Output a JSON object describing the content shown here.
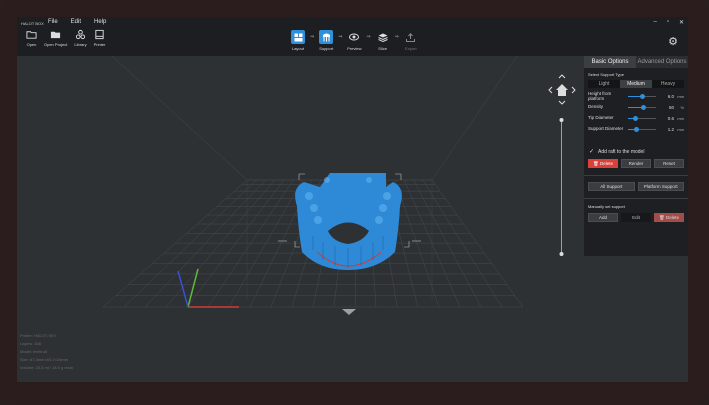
{
  "app": {
    "brand": "HALOT BOX",
    "menu": [
      "File",
      "Edit",
      "Help"
    ],
    "window_controls": [
      "–",
      "▫",
      "✕"
    ]
  },
  "toolbar": {
    "open_label": "Open",
    "open_project_label": "Open Project",
    "library_label": "Library",
    "printer_label": "Printer"
  },
  "pipeline": {
    "layout_label": "Layout",
    "support_label": "Support",
    "preview_label": "Preview",
    "slice_label": "Slice",
    "export_label": "Export",
    "active_step": "Support",
    "arrow": "⇒"
  },
  "panel": {
    "tab_basic": "Basic Options",
    "tab_advanced": "Advanced Options",
    "select_support_type": "Select Support Type",
    "types": [
      "Light",
      "Medium",
      "Heavy"
    ],
    "selected_type": "Medium",
    "params": [
      {
        "name": "Height from platform",
        "value": "6.0",
        "unit": "mm",
        "fraction": 0.5
      },
      {
        "name": "Density",
        "value": "50",
        "unit": "%",
        "fraction": 0.55
      },
      {
        "name": "Tip Diameter",
        "value": "0.6",
        "unit": "mm",
        "fraction": 0.25
      },
      {
        "name": "Support Diameter",
        "value": "1.2",
        "unit": "mm",
        "fraction": 0.3
      }
    ],
    "raft_label": "Add raft to the model",
    "raft_checked": "✓",
    "delete_label": "Delete",
    "render_label": "Render",
    "reset_label": "Reset",
    "all_support_label": "All Support",
    "platform_support_label": "Platform Support",
    "manual_label": "Manually set support",
    "add_label": "Add",
    "edit_label": "Edit",
    "delete2_label": "Delete"
  },
  "info": {
    "lines": [
      "Printer: HALOT-SKY",
      "Layers: 308",
      "Model: teeth.stl",
      "Size: 67.3mm×53.2×24mm",
      "Volume: 23.3 ml / 18.5 g resin"
    ]
  },
  "colors": {
    "accent": "#2f8fd8",
    "model": "#2e8ad6",
    "danger": "#d8403a",
    "axis_x": "#d23a34",
    "axis_y": "#5db83a",
    "axis_z": "#3a4fd2"
  }
}
